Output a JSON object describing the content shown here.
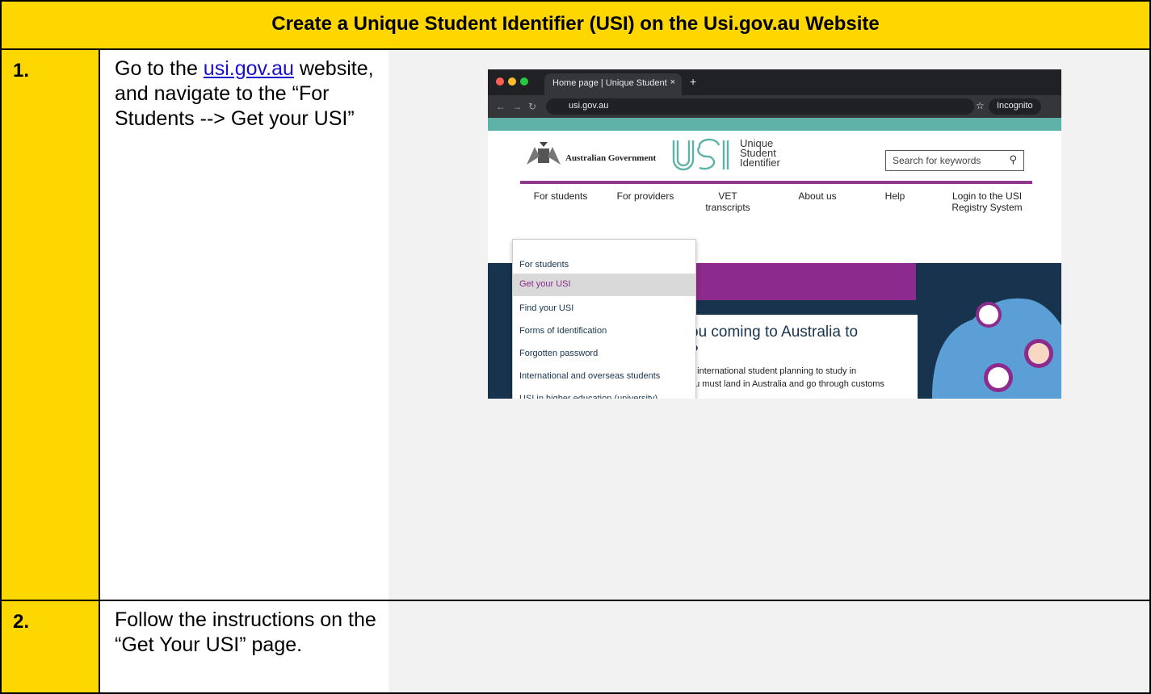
{
  "title": "Create a Unique Student Identifier (USI) on the Usi.gov.au Website",
  "steps": [
    {
      "number": "1.",
      "text_before_link": "Go to the ",
      "link_text": "usi.gov.au",
      "text_after_link": " website, and navigate to the “For Students --> Get your USI”"
    },
    {
      "number": "2.",
      "text": "Follow the instructions on the “Get Your USI” page."
    }
  ],
  "screenshot": {
    "tab_title": "Home page | Unique Student",
    "tab_close": "×",
    "tab_new": "+",
    "address": "usi.gov.au",
    "incognito": "Incognito",
    "gov_name": "Australian Government",
    "usi_words": [
      "Unique",
      "Student",
      "Identifier"
    ],
    "search_placeholder": "Search for keywords",
    "nav": [
      {
        "label": "For students"
      },
      {
        "label": "For providers"
      },
      {
        "label": "VET transcripts"
      },
      {
        "label": "About us"
      },
      {
        "label": "Help"
      },
      {
        "label": "Login to the USI Registry System"
      }
    ],
    "dropdown": [
      {
        "label": "For students",
        "active": false
      },
      {
        "label": "Get your USI",
        "active": true
      },
      {
        "label": "Find your USI",
        "active": false
      },
      {
        "label": "Forms of Identification",
        "active": false
      },
      {
        "label": "Forgotten password",
        "active": false
      },
      {
        "label": "International and overseas students",
        "active": false
      },
      {
        "label": "USI in higher education (university)",
        "active": false
      }
    ],
    "hero_heading_1": "ou coming to Australia to",
    "hero_heading_2": "?",
    "hero_body_1": "n international student planning to study in",
    "hero_body_2": "ou must land in Australia and go through customs"
  },
  "colors": {
    "header_yellow": "#ffd700",
    "link_blue": "#1a0dcc",
    "usi_purple": "#8d2a8d",
    "usi_navy": "#17334d",
    "usi_teal": "#5fb2a8"
  }
}
